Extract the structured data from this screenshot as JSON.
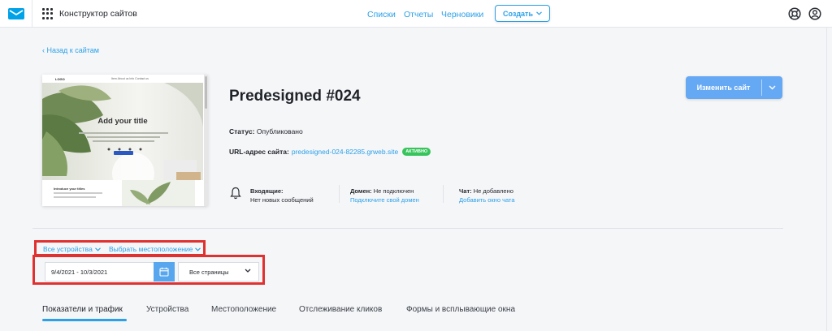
{
  "topbar": {
    "app_name": "Конструктор сайтов",
    "nav": [
      "Списки",
      "Отчеты",
      "Черновики"
    ],
    "create_label": "Создать"
  },
  "back_link": "Назад к сайтам",
  "thumbnail": {
    "logo": "LOGO",
    "menu": "Item  About us  Info  Contact us",
    "hero_title": "Add your title",
    "section_title": "Introduce your titles"
  },
  "site": {
    "title": "Predesigned #024",
    "status_label": "Статус:",
    "status_value": "Опубликовано",
    "url_label": "URL-адрес сайта:",
    "url_value": "predesigned-024-82285.grweb.site",
    "url_badge": "АКТИВНО"
  },
  "edit_button": {
    "label": "Изменить сайт"
  },
  "info": {
    "inbox_label": "Входящие:",
    "inbox_value": "Нет новых сообщений",
    "domain_label": "Домен:",
    "domain_value": "Не подключен",
    "domain_link": "Подключите свой домен",
    "chat_label": "Чат:",
    "chat_value": "Не добавлено",
    "chat_link": "Добавить окно чата"
  },
  "filters": {
    "devices": "Все устройства",
    "location": "Выбрать местоположение"
  },
  "controls": {
    "date_range": "9/4/2021 - 10/3/2021",
    "pages": "Все страницы"
  },
  "tabs": [
    "Показатели и трафик",
    "Устройства",
    "Местоположение",
    "Отслеживание кликов",
    "Формы и всплывающие окна"
  ],
  "colors": {
    "accent": "#2ca1e8",
    "edit_button": "#65a8f4",
    "badge": "#37c55b",
    "highlight": "#e03131"
  }
}
